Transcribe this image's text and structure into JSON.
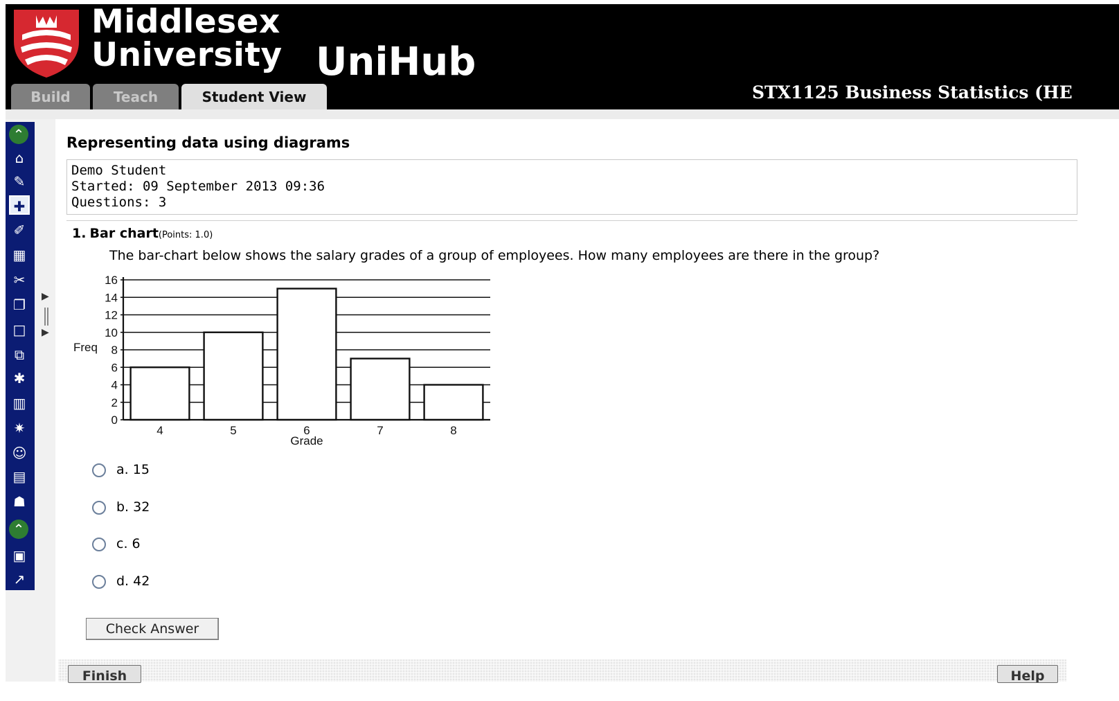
{
  "header": {
    "university_line1": "Middlesex",
    "university_line2": "University",
    "portal_name": "UniHub",
    "course_title": "STX1125 Business Statistics (HE",
    "tabs": [
      {
        "label": "Build",
        "active": false
      },
      {
        "label": "Teach",
        "active": false
      },
      {
        "label": "Student View",
        "active": true
      }
    ]
  },
  "toolbar": {
    "icons": [
      "collapse-up-icon",
      "home-icon",
      "announcements-icon",
      "groups-icon",
      "edit-icon",
      "calendar-icon",
      "tools-icon",
      "documents-icon",
      "blank-page-icon",
      "copy-icon",
      "score-icon",
      "library-icon",
      "group-add-icon",
      "profile-icon",
      "grades-icon",
      "users-icon",
      "collapse-up-icon",
      "assessment-icon",
      "reports-icon"
    ]
  },
  "quiz": {
    "title": "Representing data using diagrams",
    "student_name": "Demo Student",
    "started": "Started: 09 September 2013 09:36",
    "questions": "Questions: 3"
  },
  "question": {
    "number": "1.",
    "title": "Bar chart",
    "points": "(Points: 1.0)",
    "text": "The bar-chart below shows the salary grades of a group of employees. How many employees are there in the group?",
    "options": [
      {
        "letter": "a.",
        "value": "15"
      },
      {
        "letter": "b.",
        "value": "32"
      },
      {
        "letter": "c.",
        "value": "6"
      },
      {
        "letter": "d.",
        "value": "42"
      }
    ],
    "check_answer_label": "Check Answer"
  },
  "chart_data": {
    "type": "bar",
    "categories": [
      "4",
      "5",
      "6",
      "7",
      "8"
    ],
    "values": [
      6,
      10,
      15,
      7,
      4
    ],
    "title": "",
    "xlabel": "Grade",
    "ylabel": "Freq",
    "ylim": [
      0,
      16
    ],
    "yticks": [
      "0",
      "2",
      "4",
      "6",
      "8",
      "10",
      "12",
      "14",
      "16"
    ],
    "grid": true
  },
  "footer": {
    "finish_label": "Finish",
    "help_label": "Help"
  },
  "colors": {
    "header_bg": "#000000",
    "toolbar_bg": "#0b1c73",
    "crest_red": "#d62830"
  }
}
